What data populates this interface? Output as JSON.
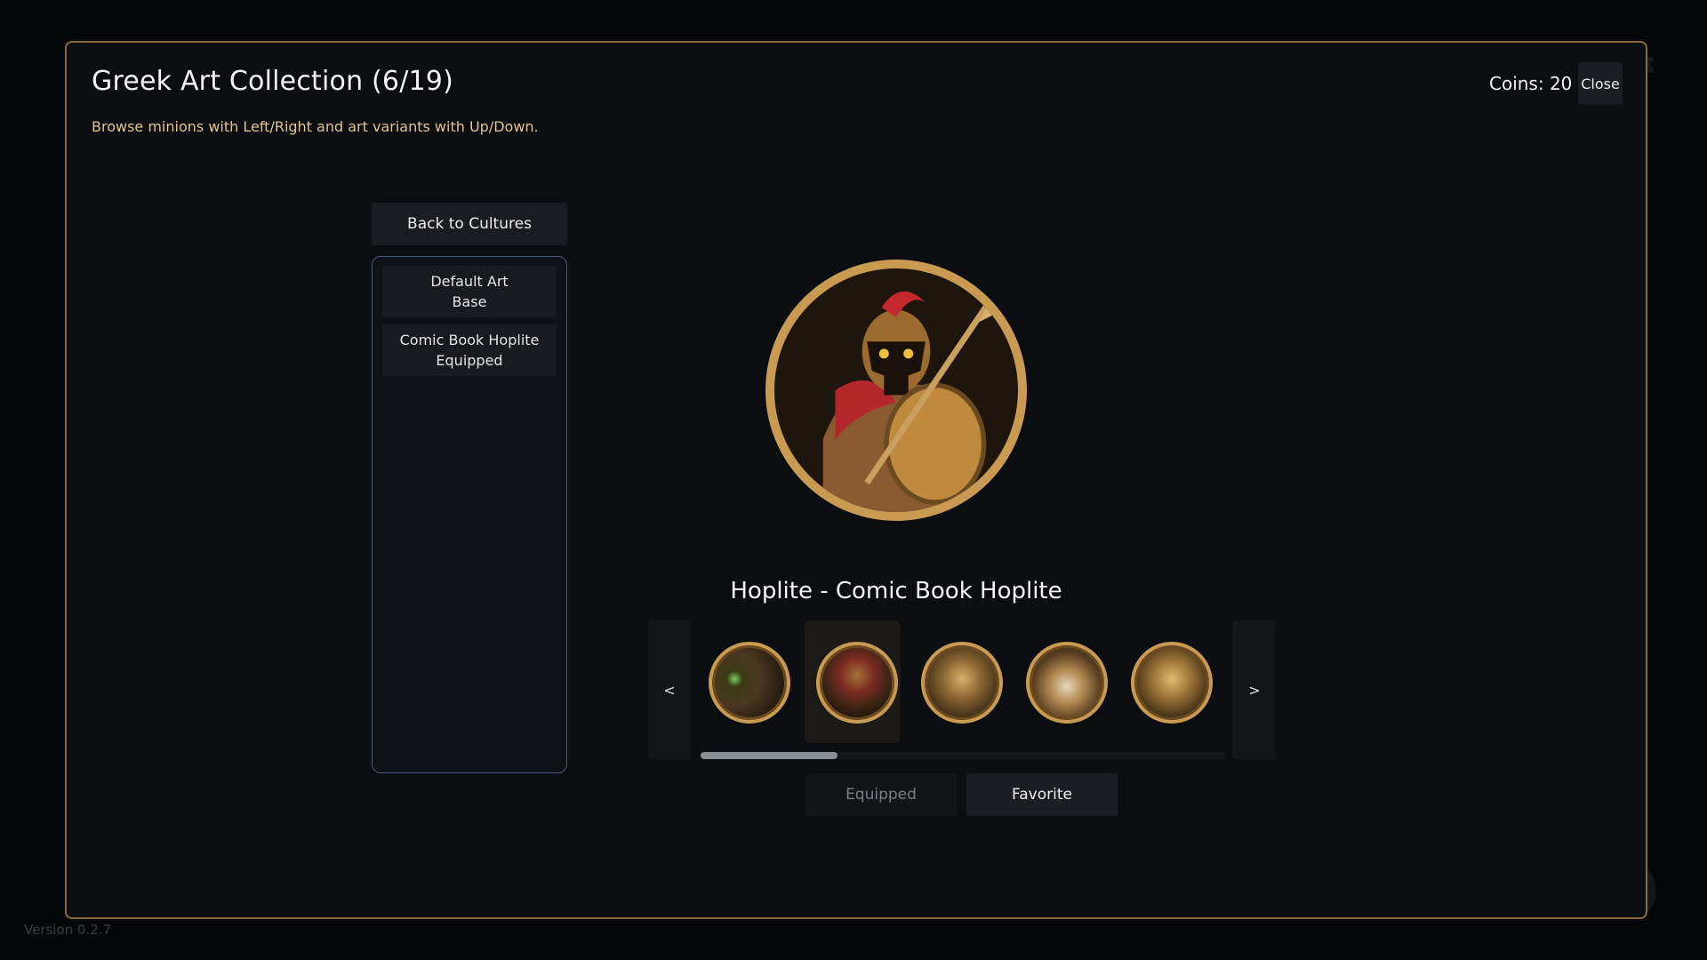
{
  "modal": {
    "title": "Greek Art Collection (6/19)",
    "subtitle": "Browse minions with Left/Right and art variants with Up/Down.",
    "coins_label": "Coins: 20",
    "close_label": "Close"
  },
  "sidebar": {
    "back_label": "Back to Cultures",
    "variants": [
      {
        "name": "Default Art",
        "status": "Base"
      },
      {
        "name": "Comic Book Hoplite",
        "status": "Equipped"
      }
    ]
  },
  "preview": {
    "art_name": "Hoplite - Comic Book Hoplite",
    "portrait_icon": "spartan-hoplite-portrait"
  },
  "carousel": {
    "prev_label": "<",
    "next_label": ">",
    "selected_index": 1,
    "thumbnails": [
      {
        "icon": "greek-figure-green-orb-portrait"
      },
      {
        "icon": "spartan-hoplite-portrait"
      },
      {
        "icon": "greek-woman-portrait"
      },
      {
        "icon": "greek-woman-reclining-portrait"
      },
      {
        "icon": "greek-woman-portrait"
      }
    ],
    "scroll_position": 0.26
  },
  "actions": {
    "equipped_label": "Equipped",
    "favorite_label": "Favorite"
  },
  "footer": {
    "version": "Version 0.2.7"
  },
  "colors": {
    "accent_gold": "#c99b52",
    "modal_border": "#8a6a3c",
    "subtitle": "#e0c58c",
    "panel_border": "#4b5a74"
  }
}
